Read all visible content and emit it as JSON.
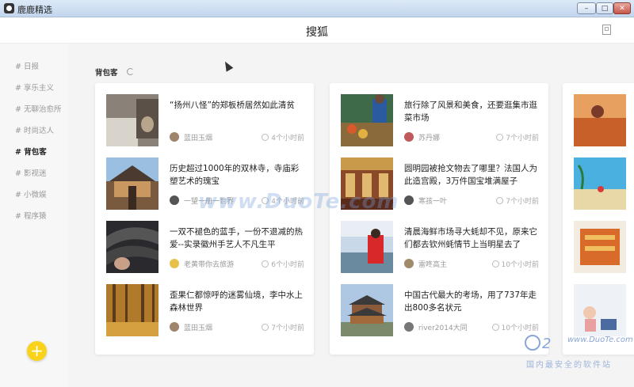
{
  "window": {
    "title": "鹿鹿精选",
    "buttons": {
      "minimize": "–",
      "maximize": "□",
      "close": "✕"
    }
  },
  "header": {
    "title": "搜狐"
  },
  "sidebar": {
    "items": [
      {
        "label": "# 日报"
      },
      {
        "label": "# 享乐主义"
      },
      {
        "label": "# 无聊治愈所"
      },
      {
        "label": "# 时尚达人"
      },
      {
        "label": "# 背包客"
      },
      {
        "label": "# 影视迷"
      },
      {
        "label": "# 小微娱"
      },
      {
        "label": "# 程序猿"
      }
    ],
    "active_index": 4,
    "fab_label": "+"
  },
  "main": {
    "section_title": "背包客",
    "columns": [
      [
        {
          "title": "“扬州八怪”的郑板桥居然如此清贫",
          "author": "蓝田玉烟",
          "time": "4个小时前"
        },
        {
          "title": "历史超过1000年的双林寺，寺庙彩塑艺术的瑰宝",
          "author": "一望一册一世界",
          "time": "4个小时前"
        },
        {
          "title": "一双不褪色的蓝手，一份不退减的热爱--实录徽州手艺人不凡生平",
          "author": "老黄带你去旅游",
          "time": "6个小时前"
        },
        {
          "title": "歪果仁都惊呼的迷雾仙境，李中水上森林世界",
          "author": "蓝田玉烟",
          "time": "7个小时前"
        }
      ],
      [
        {
          "title": "旅行除了风景和美食，还要逛集市逛菜市场",
          "author": "苏丹娜",
          "time": "7个小时前"
        },
        {
          "title": "圆明园被抢文物去了哪里？法国人为此造宫殿，3万件国宝堆满屋子",
          "author": "寒孩一叶",
          "time": "7个小时前"
        },
        {
          "title": "清晨海鲜市场寻大蚝却不见，原来它们都去钦州蚝情节上当明星去了",
          "author": "雷咚高主",
          "time": "10个小时前"
        },
        {
          "title": "中国古代最大的考场，用了737年走出800多名状元",
          "author": "river2014大同",
          "time": "10个小时前"
        }
      ]
    ]
  },
  "watermark": {
    "center": "www.DuoTe.com",
    "site": "www.DuoTe.com",
    "text": "国内最安全的软件站"
  },
  "colors": {
    "accent": "#f9d31a",
    "sidebar_bg": "#f7f7f7",
    "main_bg": "#f4f4f4"
  }
}
